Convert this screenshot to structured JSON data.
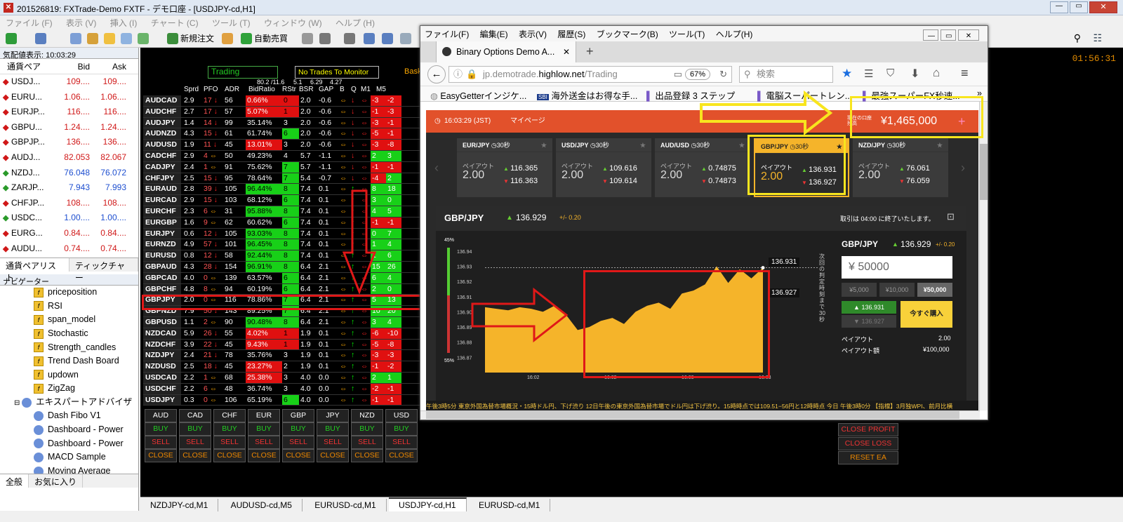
{
  "window": {
    "title": "201526819: FXTrade-Demo FXTF - デモ口座 - [USDJPY-cd,H1]"
  },
  "menu": [
    "ファイル (F)",
    "表示 (V)",
    "挿入 (I)",
    "チャート (C)",
    "ツール (T)",
    "ウィンドウ (W)",
    "ヘルプ (H)"
  ],
  "toolbar": {
    "new_order": "新規注文",
    "auto_trade": "自動売買"
  },
  "clock": "01:56:31",
  "watch": {
    "header": "気配値表示: 10:03:29",
    "col_pair": "通貨ペア",
    "col_bid": "Bid",
    "col_ask": "Ask",
    "rows": [
      {
        "sym": "USDJ...",
        "bid": "109....",
        "ask": "109....",
        "dir": "down"
      },
      {
        "sym": "EURU...",
        "bid": "1.06....",
        "ask": "1.06....",
        "dir": "down"
      },
      {
        "sym": "EURJP...",
        "bid": "116....",
        "ask": "116....",
        "dir": "down"
      },
      {
        "sym": "GBPU...",
        "bid": "1.24....",
        "ask": "1.24....",
        "dir": "down"
      },
      {
        "sym": "GBPJP...",
        "bid": "136....",
        "ask": "136....",
        "dir": "down"
      },
      {
        "sym": "AUDJ...",
        "bid": "82.053",
        "ask": "82.067",
        "dir": "down"
      },
      {
        "sym": "NZDJ...",
        "bid": "76.048",
        "ask": "76.072",
        "dir": "up"
      },
      {
        "sym": "ZARJP...",
        "bid": "7.943",
        "ask": "7.993",
        "dir": "up"
      },
      {
        "sym": "CHFJP...",
        "bid": "108....",
        "ask": "108....",
        "dir": "down"
      },
      {
        "sym": "USDC...",
        "bid": "1.00....",
        "ask": "1.00....",
        "dir": "up"
      },
      {
        "sym": "EURG...",
        "bid": "0.84....",
        "ask": "0.84....",
        "dir": "down"
      },
      {
        "sym": "AUDU...",
        "bid": "0.74....",
        "ask": "0.74....",
        "dir": "down"
      }
    ],
    "tab1": "通貨ペアリスト",
    "tab2": "ティックチャー"
  },
  "navigator": {
    "header": "ナビゲーター",
    "indicators": [
      "priceposition",
      "RSI",
      "span_model",
      "Stochastic",
      "Strength_candles",
      "Trend Dash Board",
      "updown",
      "ZigZag"
    ],
    "ea_folder": "エキスパートアドバイザ",
    "eas": [
      "Dash Fibo V1",
      "Dashboard - Power",
      "Dashboard - Power",
      "MACD Sample",
      "Moving Average"
    ],
    "tab1": "全般",
    "tab2": "お気に入り"
  },
  "dashboard": {
    "trading_label": "Trading",
    "no_trades": "No Trades To Monitor",
    "bask": "Bask",
    "subhead": [
      "80.2 /11.6",
      "5.1",
      "6.29",
      "4.27"
    ],
    "headers": [
      "Sprd",
      "PFO",
      "ADR",
      "BidRatio",
      "RStr",
      "BSR",
      "GAP",
      "B",
      "Q",
      "M1",
      "M5"
    ],
    "rows": [
      [
        "AUDCAD",
        "2.9",
        "17",
        "56",
        "0.66%",
        "0",
        "2.0",
        "-0.6",
        "-3",
        "-2"
      ],
      [
        "AUDCHF",
        "2.7",
        "17",
        "57",
        "5.07%",
        "1",
        "2.0",
        "-0.6",
        "-1",
        "-3"
      ],
      [
        "AUDJPY",
        "1.4",
        "14",
        "99",
        "35.14%",
        "3",
        "2.0",
        "-0.6",
        "-3",
        "-1"
      ],
      [
        "AUDNZD",
        "4.3",
        "15",
        "61",
        "61.74%",
        "6",
        "2.0",
        "-0.6",
        "-5",
        "-1"
      ],
      [
        "AUDUSD",
        "1.9",
        "11",
        "45",
        "13.01%",
        "3",
        "2.0",
        "-0.6",
        "-3",
        "-8"
      ],
      [
        "CADCHF",
        "2.9",
        "4",
        "50",
        "49.23%",
        "4",
        "5.7",
        "-1.1",
        "2",
        "3"
      ],
      [
        "CADJPY",
        "2.4",
        "1",
        "91",
        "75.62%",
        "7",
        "5.7",
        "-1.1",
        "-1",
        "-1"
      ],
      [
        "CHFJPY",
        "2.5",
        "15",
        "95",
        "78.64%",
        "7",
        "5.4",
        "-0.7",
        "-4",
        "2"
      ],
      [
        "EURAUD",
        "2.8",
        "39",
        "105",
        "96.44%",
        "8",
        "7.4",
        "0.1",
        "8",
        "18"
      ],
      [
        "EURCAD",
        "2.9",
        "15",
        "103",
        "68.12%",
        "6",
        "7.4",
        "0.1",
        "3",
        "0"
      ],
      [
        "EURCHF",
        "2.3",
        "6",
        "31",
        "95.88%",
        "8",
        "7.4",
        "0.1",
        "4",
        "5"
      ],
      [
        "EURGBP",
        "1.6",
        "9",
        "62",
        "60.62%",
        "6",
        "7.4",
        "0.1",
        "-1",
        "-1"
      ],
      [
        "EURJPY",
        "0.6",
        "12",
        "105",
        "93.03%",
        "8",
        "7.4",
        "0.1",
        "0",
        "7"
      ],
      [
        "EURNZD",
        "4.9",
        "57",
        "101",
        "96.45%",
        "8",
        "7.4",
        "0.1",
        "1",
        "4"
      ],
      [
        "EURUSD",
        "0.8",
        "12",
        "58",
        "92.44%",
        "8",
        "7.4",
        "0.1",
        "1",
        "6"
      ],
      [
        "GBPAUD",
        "4.3",
        "28",
        "154",
        "96.91%",
        "8",
        "6.4",
        "2.1",
        "15",
        "26"
      ],
      [
        "GBPCAD",
        "4.0",
        "0",
        "139",
        "63.57%",
        "6",
        "6.4",
        "2.1",
        "6",
        "4"
      ],
      [
        "GBPCHF",
        "4.8",
        "8",
        "94",
        "60.19%",
        "6",
        "6.4",
        "2.1",
        "2",
        "0"
      ],
      [
        "GBPJPY",
        "2.0",
        "0",
        "116",
        "78.86%",
        "7",
        "6.4",
        "2.1",
        "5",
        "13"
      ],
      [
        "GBPNZD",
        "7.9",
        "50",
        "143",
        "89.25%",
        "7",
        "6.4",
        "2.1",
        "10",
        "20"
      ],
      [
        "GBPUSD",
        "1.1",
        "2",
        "90",
        "90.48%",
        "8",
        "6.4",
        "2.1",
        "3",
        "4"
      ],
      [
        "NZDCAD",
        "5.9",
        "26",
        "55",
        "4.02%",
        "1",
        "1.9",
        "0.1",
        "-6",
        "-10"
      ],
      [
        "NZDCHF",
        "3.9",
        "22",
        "45",
        "9.43%",
        "1",
        "1.9",
        "0.1",
        "-5",
        "-8"
      ],
      [
        "NZDJPY",
        "2.4",
        "21",
        "78",
        "35.76%",
        "3",
        "1.9",
        "0.1",
        "-3",
        "-3"
      ],
      [
        "NZDUSD",
        "2.5",
        "18",
        "45",
        "23.27%",
        "2",
        "1.9",
        "0.1",
        "-1",
        "-2"
      ],
      [
        "USDCAD",
        "2.2",
        "1",
        "68",
        "25.38%",
        "3",
        "4.0",
        "0.0",
        "2",
        "1"
      ],
      [
        "USDCHF",
        "2.2",
        "6",
        "48",
        "36.74%",
        "3",
        "4.0",
        "0.0",
        "-2",
        "-1"
      ],
      [
        "USDJPY",
        "0.3",
        "0",
        "106",
        "65.19%",
        "6",
        "4.0",
        "0.0",
        "-1",
        "-1"
      ]
    ],
    "currencies": [
      "AUD",
      "CAD",
      "CHF",
      "EUR",
      "GBP",
      "JPY",
      "NZD",
      "USD"
    ],
    "buy": "BUY",
    "sell": "SELL",
    "close": "CLOSE",
    "close_profit": "CLOSE PROFIT",
    "close_loss": "CLOSE LOSS",
    "reset_ea": "RESET EA"
  },
  "chart_tabs": [
    "NZDJPY-cd,M1",
    "AUDUSD-cd,M5",
    "EURUSD-cd,M1",
    "USDJPY-cd,H1",
    "EURUSD-cd,M1"
  ],
  "firefox": {
    "menu": [
      "ファイル(F)",
      "編集(E)",
      "表示(V)",
      "履歴(S)",
      "ブックマーク(B)",
      "ツール(T)",
      "ヘルプ(H)"
    ],
    "tab_title": "Binary Options Demo A...",
    "url_prefix": "jp.demotrade.",
    "url_domain": "highlow.net",
    "url_path": "/Trading",
    "zoom": "67%",
    "search_placeholder": "検索",
    "bookmarks": [
      "EasyGetterインジケ...",
      "海外送金はお得な手...",
      "出品登録 3 ステップ",
      "電脳スーパートレン...",
      "最強スーパーFX秒速..."
    ]
  },
  "highlow": {
    "time": "16:03:29 (JST)",
    "mypage": "マイページ",
    "balance_label": "現在の口座残高",
    "balance": "¥1,465,000",
    "cards": [
      {
        "pair": "EUR/JPY",
        "timer": "30秒",
        "payout_label": "ペイアウト",
        "payout": "2.00",
        "up": "116.365",
        "down": "116.363"
      },
      {
        "pair": "USD/JPY",
        "timer": "30秒",
        "payout_label": "ペイアウト",
        "payout": "2.00",
        "up": "109.616",
        "down": "109.614"
      },
      {
        "pair": "AUD/USD",
        "timer": "30秒",
        "payout_label": "ペイアウト",
        "payout": "2.00",
        "up": "0.74875",
        "down": "0.74873"
      },
      {
        "pair": "GBP/JPY",
        "timer": "30秒",
        "payout_label": "ペイアウト",
        "payout": "2.00",
        "up": "136.931",
        "down": "136.927"
      },
      {
        "pair": "NZD/JPY",
        "timer": "30秒",
        "payout_label": "ペイアウト",
        "payout": "2.00",
        "up": "76.061",
        "down": "76.059"
      }
    ],
    "chart_pair": "GBP/JPY",
    "chart_price": "136.929",
    "chart_change": "+/- 0.20",
    "closes_note": "取引は 04:00 に終了いたします。",
    "y_ticks": [
      "136.94",
      "136.93",
      "136.92",
      "136.91",
      "136.90",
      "136.89",
      "136.88",
      "136.87"
    ],
    "x_ticks": [
      "16:02",
      "16:02",
      "16:03",
      "16:03"
    ],
    "pct_top": "45%",
    "pct_bottom": "55%",
    "marker_up": "136.931",
    "marker_down": "136.927",
    "vertical_note": "次回の判定時刻まで30秒",
    "panel_pair": "GBP/JPY",
    "panel_price": "136.929",
    "panel_change": "+/- 0.20",
    "amount": "¥ 50000",
    "presets": [
      "¥5,000",
      "¥10,000",
      "¥50,000"
    ],
    "high_price": "136.931",
    "low_price": "136.927",
    "buy_now": "今すぐ購入",
    "payout_label": "ペイアウト",
    "payout_value": "2.00",
    "payout_amount_label": "ペイアウト額",
    "payout_amount": "¥100,000",
    "ticker": "午後3時5分 東京外国為替市場概況・15時ドル円、下げ渋り 12日午後の東京外国為替市場でドル円は下げ渋り。15時時点では109.51−56円と12時時点 今日 午後3時0分 【指標】3月独WPI、前月比横"
  },
  "chart_data": {
    "type": "area",
    "series": [
      {
        "name": "",
        "values": [
          136.903,
          136.902,
          136.901,
          136.903,
          136.902,
          136.9,
          136.904,
          136.898,
          136.888,
          136.89,
          136.894,
          136.896,
          136.892,
          136.9,
          136.904,
          136.906,
          136.902,
          136.912,
          136.914,
          136.918,
          136.93,
          136.919,
          136.928,
          136.922,
          136.929
        ]
      }
    ],
    "ylim": [
      136.86,
      136.945
    ]
  },
  "colors": {
    "up": "#00e000",
    "down": "#ff1010",
    "orange": "#e2512b",
    "gold": "#f5b42a",
    "highlight_yellow": "#f8e51e",
    "highlight_red": "#e01818"
  }
}
